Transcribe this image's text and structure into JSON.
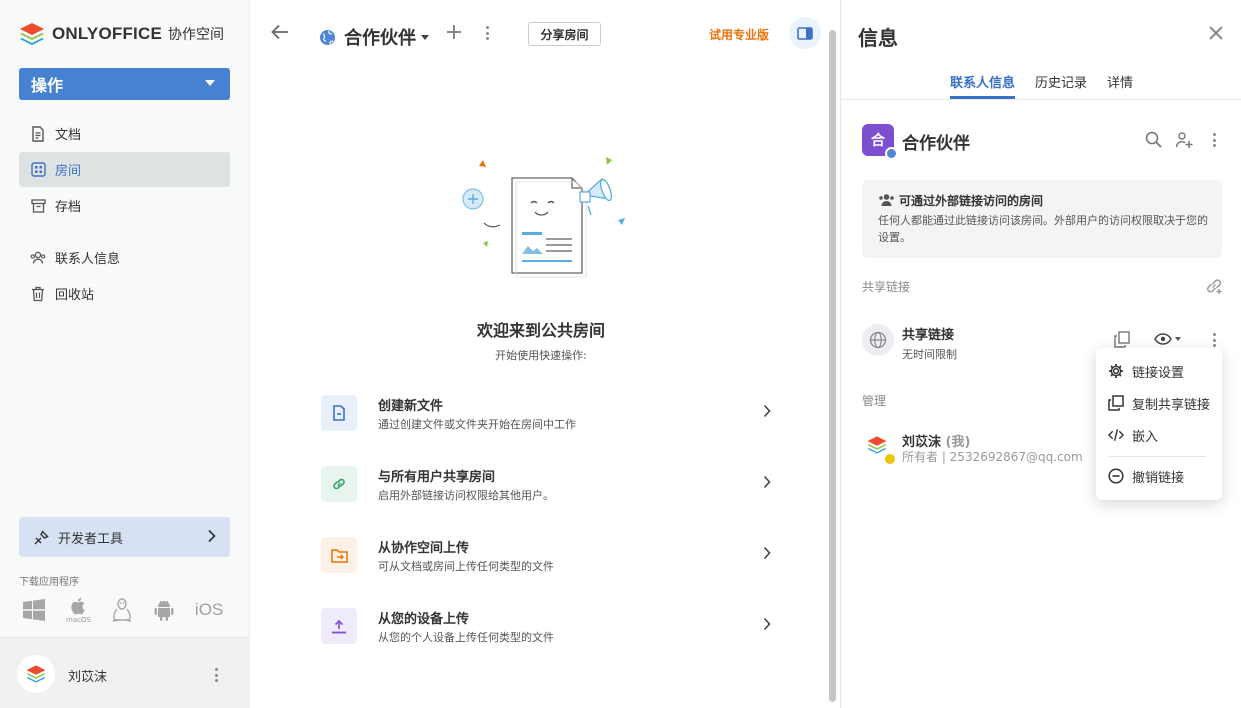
{
  "sidebar": {
    "logo_text": "ONLYOFFICE",
    "logo_sub": "协作空间",
    "actions_label": "操作",
    "nav": [
      {
        "label": "文档",
        "icon": "document-icon"
      },
      {
        "label": "房间",
        "icon": "rooms-icon"
      },
      {
        "label": "存档",
        "icon": "archive-icon"
      },
      {
        "label": "联系人信息",
        "icon": "contacts-icon"
      },
      {
        "label": "回收站",
        "icon": "trash-icon"
      }
    ],
    "dev_tools_label": "开发者工具",
    "download_label": "下载应用程序",
    "apps": {
      "macos": "macOS",
      "ios": "iOS"
    },
    "user_name": "刘苡沫"
  },
  "main": {
    "room_title": "合作伙伴",
    "share_room_label": "分享房间",
    "try_pro_label": "试用专业版",
    "welcome_title": "欢迎来到公共房间",
    "welcome_sub": "开始使用快速操作:",
    "quick_actions": [
      {
        "title": "创建新文件",
        "desc": "通过创建文件或文件夹开始在房间中工作",
        "color": "#3b72c5",
        "bg": "#e8f0fb"
      },
      {
        "title": "与所有用户共享房间",
        "desc": "启用外部链接访问权限给其他用户。",
        "color": "#2fa66f",
        "bg": "#e7f5ee"
      },
      {
        "title": "从协作空间上传",
        "desc": "可从文档或房间上传任何类型的文件",
        "color": "#ed7309",
        "bg": "#fdf1e6"
      },
      {
        "title": "从您的设备上传",
        "desc": "从您的个人设备上传任何类型的文件",
        "color": "#7c4fd1",
        "bg": "#f0ebfa"
      }
    ]
  },
  "info": {
    "title": "信息",
    "tabs": [
      "联系人信息",
      "历史记录",
      "详情"
    ],
    "room_icon_letter": "合",
    "room_name": "合作伙伴",
    "notice_title": "可通过外部链接访问的房间",
    "notice_body": "任何人都能通过此链接访问该房间。外部用户的访问权限取决于您的设置。",
    "share_links_label": "共享链接",
    "share_link_title": "共享链接",
    "share_link_sub": "无时间限制",
    "manage_label": "管理",
    "owner_name": "刘苡沫",
    "owner_me": "(我)",
    "owner_sub": "所有者 | 2532692867@qq.com"
  },
  "context_menu": [
    {
      "label": "链接设置",
      "icon": "gear-icon"
    },
    {
      "label": "复制共享链接",
      "icon": "copy-icon"
    },
    {
      "label": "嵌入",
      "icon": "code-icon"
    },
    {
      "label": "撤销链接",
      "icon": "minus-circle-icon"
    }
  ],
  "colors": {
    "accent": "#4781d1",
    "link": "#3b72c5",
    "orange": "#ed7309",
    "room": "#7c4fd1"
  }
}
